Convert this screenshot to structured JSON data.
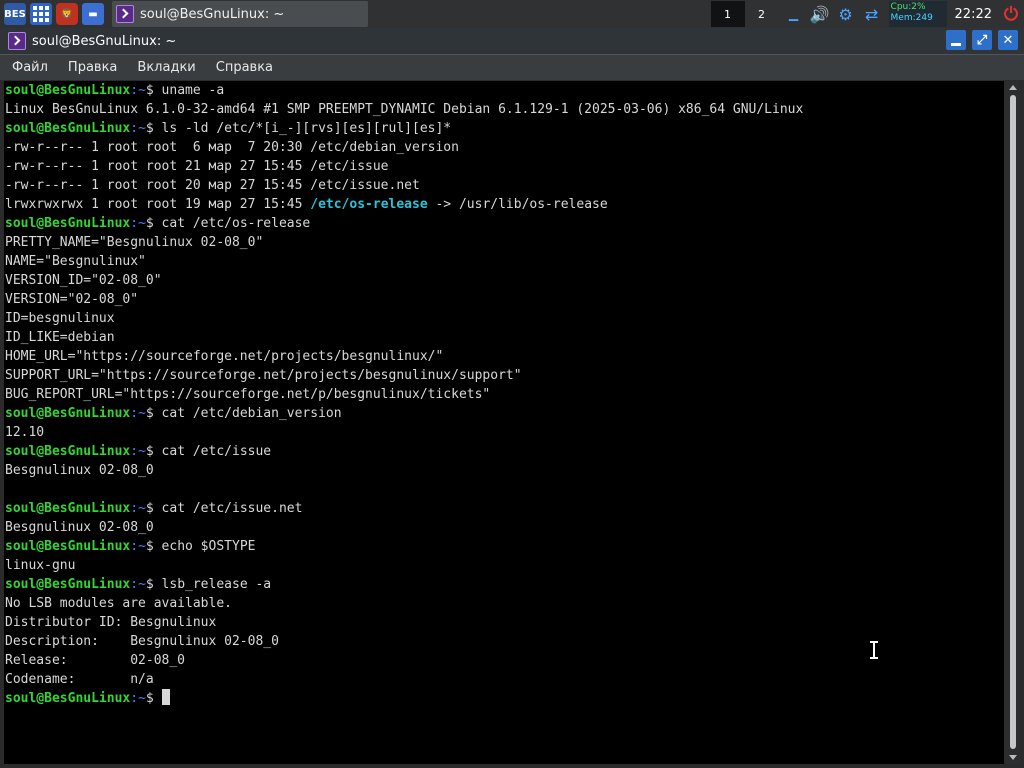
{
  "taskbar": {
    "bes_label": "BES",
    "task_title": "soul@BesGnuLinux: ~",
    "workspaces": [
      "1",
      "2"
    ],
    "cpu": "Cpu:2%",
    "mem": "Mem:249",
    "clock": "22:22"
  },
  "window": {
    "title": "soul@BesGnuLinux: ~"
  },
  "menu": [
    "Файл",
    "Правка",
    "Вкладки",
    "Справка"
  ],
  "terminal": {
    "user_host": "soul@BesGnuLinux",
    "path": "~",
    "prompt_symbol": "$",
    "lines": [
      {
        "type": "prompt",
        "cmd": "uname -a"
      },
      {
        "type": "out",
        "text": "Linux BesGnuLinux 6.1.0-32-amd64 #1 SMP PREEMPT_DYNAMIC Debian 6.1.129-1 (2025-03-06) x86_64 GNU/Linux"
      },
      {
        "type": "prompt",
        "cmd": "ls -ld /etc/*[i_-][rvs][es][rul][es]*"
      },
      {
        "type": "out",
        "text": "-rw-r--r-- 1 root root  6 мар  7 20:30 /etc/debian_version"
      },
      {
        "type": "out",
        "text": "-rw-r--r-- 1 root root 21 мар 27 15:45 /etc/issue"
      },
      {
        "type": "out",
        "text": "-rw-r--r-- 1 root root 20 мар 27 15:45 /etc/issue.net"
      },
      {
        "type": "link",
        "pre": "lrwxrwxrwx 1 root root 19 мар 27 15:45 ",
        "name": "/etc/os-release",
        "post": " -> /usr/lib/os-release"
      },
      {
        "type": "prompt",
        "cmd": "cat /etc/os-release"
      },
      {
        "type": "out",
        "text": "PRETTY_NAME=\"Besgnulinux 02-08_0\""
      },
      {
        "type": "out",
        "text": "NAME=\"Besgnulinux\""
      },
      {
        "type": "out",
        "text": "VERSION_ID=\"02-08_0\""
      },
      {
        "type": "out",
        "text": "VERSION=\"02-08_0\""
      },
      {
        "type": "out",
        "text": "ID=besgnulinux"
      },
      {
        "type": "out",
        "text": "ID_LIKE=debian"
      },
      {
        "type": "out",
        "text": "HOME_URL=\"https://sourceforge.net/projects/besgnulinux/\""
      },
      {
        "type": "out",
        "text": "SUPPORT_URL=\"https://sourceforge.net/projects/besgnulinux/support\""
      },
      {
        "type": "out",
        "text": "BUG_REPORT_URL=\"https://sourceforge.net/p/besgnulinux/tickets\""
      },
      {
        "type": "prompt",
        "cmd": "cat /etc/debian_version"
      },
      {
        "type": "out",
        "text": "12.10"
      },
      {
        "type": "prompt",
        "cmd": "cat /etc/issue"
      },
      {
        "type": "out",
        "text": "Besgnulinux 02-08_0"
      },
      {
        "type": "out",
        "text": ""
      },
      {
        "type": "prompt",
        "cmd": "cat /etc/issue.net"
      },
      {
        "type": "out",
        "text": "Besgnulinux 02-08_0"
      },
      {
        "type": "prompt",
        "cmd": "echo $OSTYPE"
      },
      {
        "type": "out",
        "text": "linux-gnu"
      },
      {
        "type": "prompt",
        "cmd": "lsb_release -a"
      },
      {
        "type": "out",
        "text": "No LSB modules are available."
      },
      {
        "type": "out",
        "text": "Distributor ID:\tBesgnulinux"
      },
      {
        "type": "out",
        "text": "Description:\tBesgnulinux 02-08_0"
      },
      {
        "type": "out",
        "text": "Release:\t02-08_0"
      },
      {
        "type": "out",
        "text": "Codename:\tn/a"
      },
      {
        "type": "prompt",
        "cmd": "",
        "cursor": true
      }
    ]
  },
  "colors": {
    "prompt_user": "#35d435",
    "prompt_sep": "#4a7dff",
    "symlink": "#2ec3d6",
    "accent": "#2d6fc9"
  }
}
